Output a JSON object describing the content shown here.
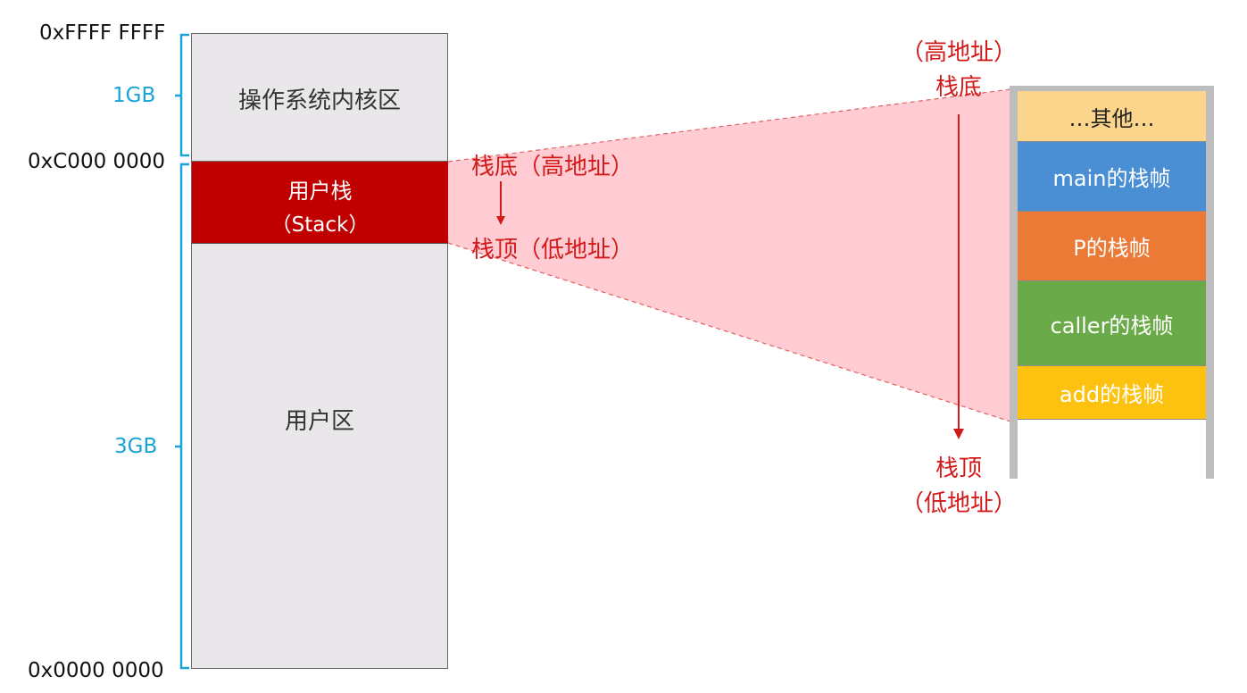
{
  "address_labels": {
    "top": "0xFFFF FFFF",
    "kernel_boundary": "0xC000 0000",
    "bottom": "0x0000 0000"
  },
  "size_labels": {
    "kernel": "1GB",
    "user": "3GB"
  },
  "memory_regions": {
    "kernel": "操作系统内核区",
    "user_stack_line1": "用户栈",
    "user_stack_line2": "（Stack）",
    "user_area": "用户区"
  },
  "stack_annotations": {
    "bottom_label": "栈底（高地址）",
    "top_label": "栈顶（低地址）"
  },
  "right_annotations": {
    "top_addr": "（高地址）",
    "top_name": "栈底",
    "bottom_name": "栈顶",
    "bottom_addr": "（低地址）"
  },
  "stack_frames": [
    {
      "label": "…其他…",
      "color": "#fbd58b",
      "text_color": "#222222"
    },
    {
      "label": "main的栈帧",
      "color": "#4a8ed3",
      "text_color": "#ffffff"
    },
    {
      "label": "P的栈帧",
      "color": "#ea7a35",
      "text_color": "#ffffff"
    },
    {
      "label": "caller的栈帧",
      "color": "#6aaa48",
      "text_color": "#ffffff"
    },
    {
      "label": "add的栈帧",
      "color": "#fcc20f",
      "text_color": "#ffffff"
    }
  ],
  "colors": {
    "memory_bg": "#e9e7e9",
    "user_stack": "#c00000",
    "brace": "#1aa3d9",
    "annotation_red": "#d21a1a",
    "projection": "#ffc7ce"
  }
}
